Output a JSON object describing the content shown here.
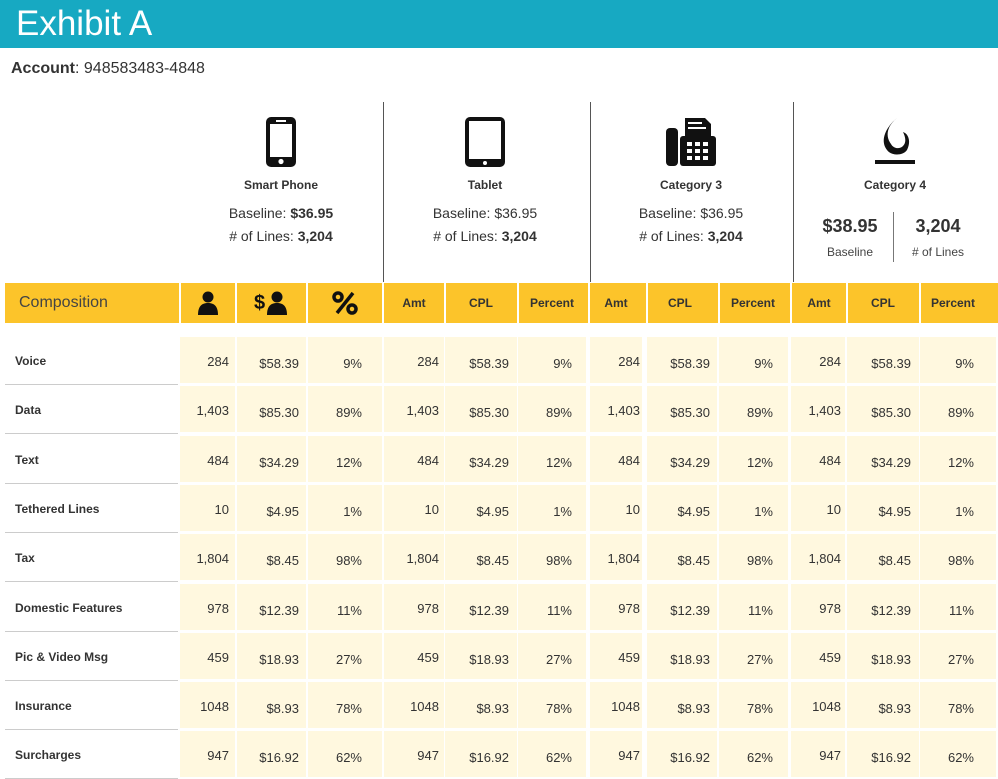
{
  "title": "Exhibit A",
  "account": {
    "label": "Account",
    "value": ": 948583483-4848"
  },
  "categories": [
    {
      "name": "Smart Phone",
      "icon": "smartphone-icon",
      "baseline_label": "Baseline: ",
      "baseline": "$36.95",
      "lines_label": "# of Lines: ",
      "lines": "3,204"
    },
    {
      "name": "Tablet",
      "icon": "tablet-icon",
      "baseline_label": "Baseline: $36.95",
      "lines_label": "# of Lines: ",
      "lines": "3,204"
    },
    {
      "name": "Category 3",
      "icon": "fax-machine-icon",
      "baseline_label": "Baseline: $36.95",
      "lines_label": "# of Lines: ",
      "lines": "3,204"
    },
    {
      "name": "Category 4",
      "icon": "flame-icon",
      "baseline": "$38.95",
      "baseline_label": "Baseline",
      "lines": "3,204",
      "lines_label": "# of Lines"
    }
  ],
  "header": {
    "composition": "Composition",
    "group1_icons": [
      "user-icon",
      "dollar-user-icon",
      "percent-icon"
    ],
    "group_cols": [
      "Amt",
      "CPL",
      "Percent"
    ]
  },
  "rows": [
    {
      "label": "Voice",
      "amt": "284",
      "cpl": "$58.39",
      "pct": "9%"
    },
    {
      "label": "Data",
      "amt": "1,403",
      "cpl": "$85.30",
      "pct": "89%"
    },
    {
      "label": "Text",
      "amt": "484",
      "cpl": "$34.29",
      "pct": "12%"
    },
    {
      "label": "Tethered Lines",
      "amt": "10",
      "cpl": "$4.95",
      "pct": "1%"
    },
    {
      "label": "Tax",
      "amt": "1,804",
      "cpl": "$8.45",
      "pct": "98%"
    },
    {
      "label": "Domestic Features",
      "amt": "978",
      "cpl": "$12.39",
      "pct": "11%"
    },
    {
      "label": "Pic & Video Msg",
      "amt": "459",
      "cpl": "$18.93",
      "pct": "27%"
    },
    {
      "label": "Insurance",
      "amt": "1048",
      "cpl": "$8.93",
      "pct": "78%"
    },
    {
      "label": "Surcharges",
      "amt": "947",
      "cpl": "$16.92",
      "pct": "62%"
    }
  ],
  "colors": {
    "title_bar": "#17a9c2",
    "header": "#fcc42a",
    "cell_bg": "#fff8df"
  }
}
